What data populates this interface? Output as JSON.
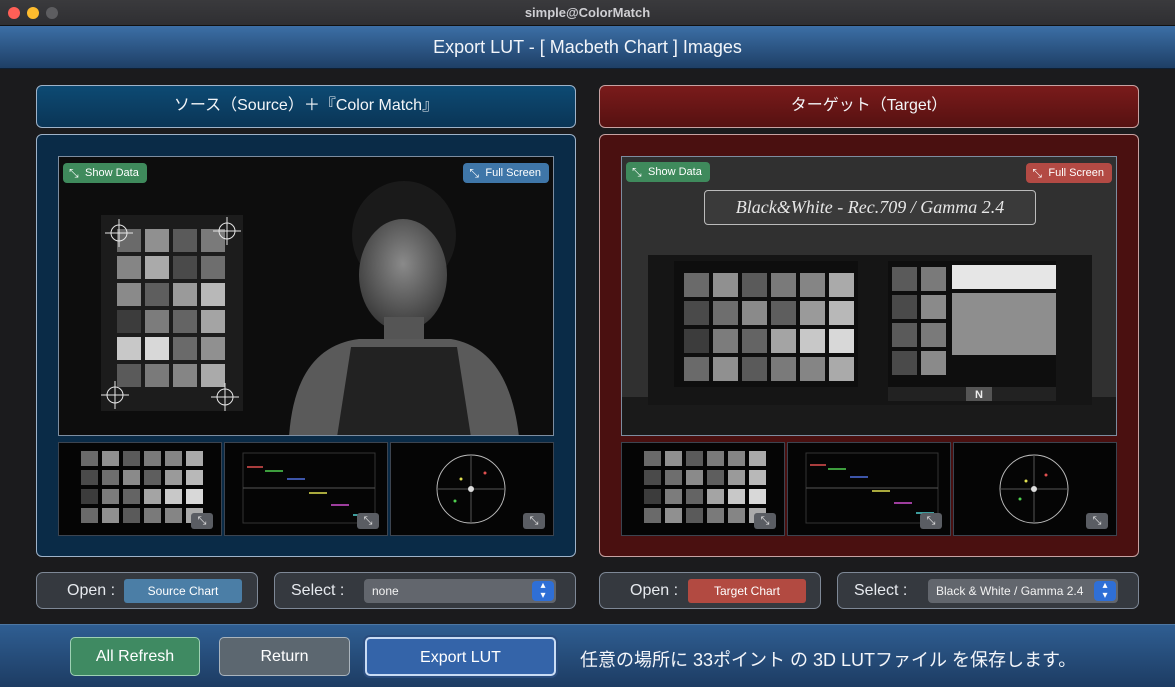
{
  "window": {
    "title": "simple@ColorMatch"
  },
  "header": {
    "title": "Export LUT - [ Macbeth Chart ] Images"
  },
  "source": {
    "title": "ソース（Source）＋『Color Match』",
    "show_data": "Show Data",
    "full_screen": "Full Screen",
    "open_label": "Open :",
    "chart_button": "Source Chart",
    "select_label": "Select :",
    "select_value": "none"
  },
  "target": {
    "title": "ターゲット（Target）",
    "show_data": "Show Data",
    "full_screen": "Full Screen",
    "banner": "Black&White - Rec.709 / Gamma 2.4",
    "open_label": "Open :",
    "chart_button": "Target Chart",
    "select_label": "Select :",
    "select_value": "Black & White / Gamma 2.4",
    "slate_mark": "N"
  },
  "footer": {
    "refresh": "All Refresh",
    "return": "Return",
    "export": "Export LUT",
    "message": "任意の場所に 33ポイント の 3D LUTファイル を保存します。"
  },
  "icons": {
    "expand": "expand-arrows-icon",
    "chevron": "updown-chevron-icon"
  },
  "colors": {
    "source_accent": "#0a3556",
    "target_accent": "#561111",
    "primary_blue": "#3464a9",
    "refresh_green": "#3f8a62"
  }
}
